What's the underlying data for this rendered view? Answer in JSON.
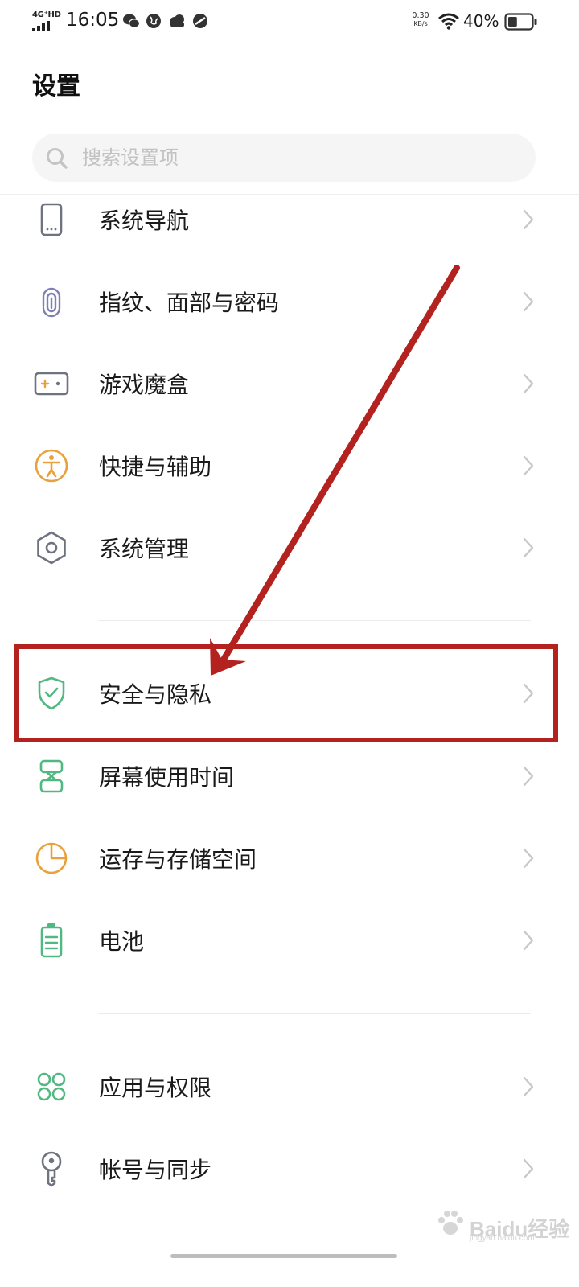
{
  "status_bar": {
    "network": "4G⁺HD",
    "time": "16:05",
    "speed_value": "0.30",
    "speed_unit": "KB/s",
    "battery_percent": "40%",
    "battery_level": 0.4,
    "app_icons": [
      "wechat-icon",
      "globe-icon",
      "weather-cloud-icon",
      "browser-icon"
    ]
  },
  "header": {
    "title": "设置"
  },
  "search": {
    "placeholder": "搜索设置项"
  },
  "items": [
    {
      "label": "系统导航",
      "icon": "phone-navigation-icon",
      "color": "#6f7380"
    },
    {
      "label": "指纹、面部与密码",
      "icon": "fingerprint-icon",
      "color": "#7d7fb7"
    },
    {
      "label": "游戏魔盒",
      "icon": "gamepad-icon",
      "color": "#6f7380",
      "accent": "#e9a23b"
    },
    {
      "label": "快捷与辅助",
      "icon": "accessibility-icon",
      "color": "#e9a23b"
    },
    {
      "label": "系统管理",
      "icon": "hexagon-settings-icon",
      "color": "#6f7380"
    },
    {
      "label": "安全与隐私",
      "icon": "shield-check-icon",
      "color": "#52b882"
    },
    {
      "label": "屏幕使用时间",
      "icon": "hourglass-icon",
      "color": "#52b882"
    },
    {
      "label": "运存与存储空间",
      "icon": "pie-chart-icon",
      "color": "#e9a23b"
    },
    {
      "label": "电池",
      "icon": "battery-icon",
      "color": "#52b882"
    },
    {
      "label": "应用与权限",
      "icon": "apps-grid-icon",
      "color": "#52b882"
    },
    {
      "label": "帐号与同步",
      "icon": "key-icon",
      "color": "#6f7380"
    }
  ],
  "colors": {
    "annotation_red": "#b3221f",
    "chevron": "#c8c8c8"
  },
  "watermark": {
    "text": "Baidu经验",
    "sub": "jingyan.baidu.com"
  }
}
